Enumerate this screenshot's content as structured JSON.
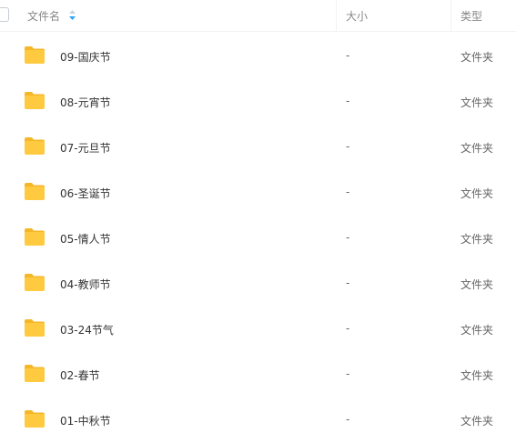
{
  "header": {
    "name_label": "文件名",
    "size_label": "大小",
    "type_label": "类型"
  },
  "colors": {
    "folder": "#ffc940",
    "folder_tab": "#f5b728",
    "sort_accent": "#2ba2ff"
  },
  "files": [
    {
      "name": "09-国庆节",
      "size": "-",
      "type": "文件夹",
      "icon": "folder-icon"
    },
    {
      "name": "08-元宵节",
      "size": "-",
      "type": "文件夹",
      "icon": "folder-icon"
    },
    {
      "name": "07-元旦节",
      "size": "-",
      "type": "文件夹",
      "icon": "folder-icon"
    },
    {
      "name": "06-圣诞节",
      "size": "-",
      "type": "文件夹",
      "icon": "folder-icon"
    },
    {
      "name": "05-情人节",
      "size": "-",
      "type": "文件夹",
      "icon": "folder-icon"
    },
    {
      "name": "04-教师节",
      "size": "-",
      "type": "文件夹",
      "icon": "folder-icon"
    },
    {
      "name": "03-24节气",
      "size": "-",
      "type": "文件夹",
      "icon": "folder-icon"
    },
    {
      "name": "02-春节",
      "size": "-",
      "type": "文件夹",
      "icon": "folder-icon"
    },
    {
      "name": "01-中秋节",
      "size": "-",
      "type": "文件夹",
      "icon": "folder-icon"
    }
  ]
}
